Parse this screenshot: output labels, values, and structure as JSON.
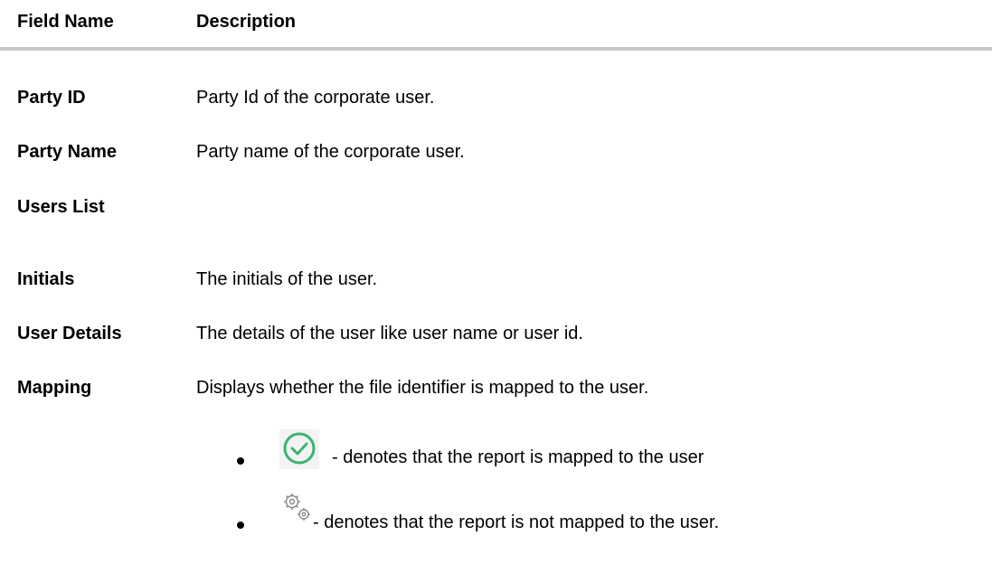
{
  "header": {
    "field_col": "Field Name",
    "desc_col": "Description"
  },
  "rows": [
    {
      "field": "Party ID",
      "desc": "Party Id of the corporate user."
    },
    {
      "field": "Party Name",
      "desc": "Party name of the corporate user."
    },
    {
      "field": "Users List",
      "desc": ""
    },
    {
      "field": "Initials",
      "desc": "The initials of the user."
    },
    {
      "field": "User Details",
      "desc": "The details of the user like user name or user id."
    },
    {
      "field": "Mapping",
      "desc": "Displays whether the file identifier is mapped to the user."
    }
  ],
  "mapping_bullets": [
    {
      "icon": "check-circle-icon",
      "text": "- denotes that the report is mapped to the user"
    },
    {
      "icon": "gears-icon",
      "text": "- denotes that the report is not mapped to the user."
    }
  ],
  "colors": {
    "header_rule": "#c8c8c8",
    "check_green": "#3cb371",
    "gear_gray": "#888888"
  }
}
